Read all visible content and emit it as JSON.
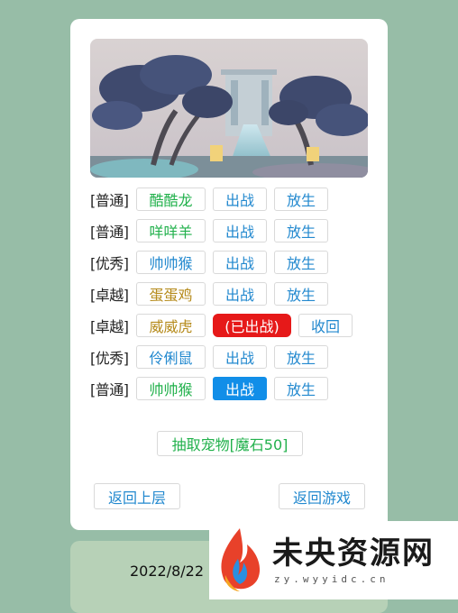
{
  "pets": [
    {
      "rarity": "[普通]",
      "name": "酷酷龙",
      "name_color": "green",
      "action": "出战",
      "action_style": "outline",
      "release": "放生"
    },
    {
      "rarity": "[普通]",
      "name": "咩咩羊",
      "name_color": "green",
      "action": "出战",
      "action_style": "outline",
      "release": "放生"
    },
    {
      "rarity": "[优秀]",
      "name": "帅帅猴",
      "name_color": "blue",
      "action": "出战",
      "action_style": "outline",
      "release": "放生"
    },
    {
      "rarity": "[卓越]",
      "name": "蛋蛋鸡",
      "name_color": "gold",
      "action": "出战",
      "action_style": "outline",
      "release": "放生"
    },
    {
      "rarity": "[卓越]",
      "name": "威威虎",
      "name_color": "gold",
      "action": "(已出战)",
      "action_style": "active",
      "release": "收回"
    },
    {
      "rarity": "[优秀]",
      "name": "伶俐鼠",
      "name_color": "blue",
      "action": "出战",
      "action_style": "outline",
      "release": "放生"
    },
    {
      "rarity": "[普通]",
      "name": "帅帅猴",
      "name_color": "green",
      "action": "出战",
      "action_style": "primary",
      "release": "放生"
    }
  ],
  "draw_button": "抽取宠物[魔石50]",
  "back_up_button": "返回上层",
  "back_game_button": "返回游戏",
  "footer_date": "2022/8/22",
  "watermark": {
    "title": "未央资源网",
    "sub": "zy.wyyidc.cn"
  },
  "colors": {
    "background": "#97bda7",
    "green": "#22b14c",
    "blue": "#2389cf",
    "gold": "#b58a1a",
    "red": "#e61919",
    "primary": "#118ee8"
  }
}
